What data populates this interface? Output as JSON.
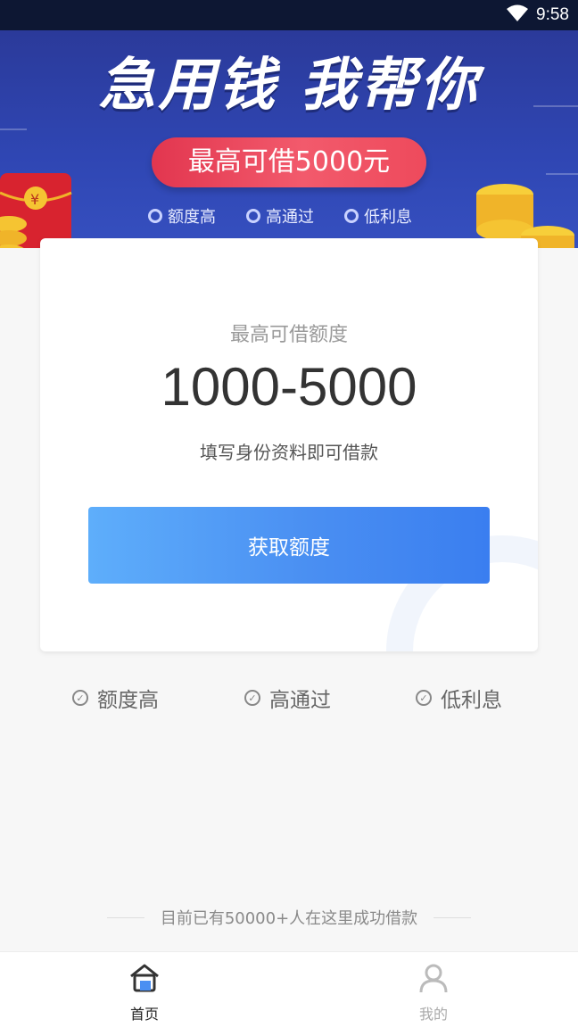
{
  "status_bar": {
    "time": "9:58"
  },
  "banner": {
    "title": "急用钱 我帮你",
    "pill": "最高可借5000元",
    "features": [
      "额度高",
      "高通过",
      "低利息"
    ]
  },
  "card": {
    "label": "最高可借额度",
    "amount": "1000-5000",
    "hint": "填写身份资料即可借款",
    "button": "获取额度"
  },
  "features": [
    "额度高",
    "高通过",
    "低利息"
  ],
  "footer_note": "目前已有50000+人在这里成功借款",
  "bottom_nav": {
    "items": [
      {
        "label": "首页",
        "icon": "home-icon",
        "active": true
      },
      {
        "label": "我的",
        "icon": "user-icon",
        "active": false
      }
    ]
  },
  "colors": {
    "banner": "#2f46b3",
    "pill": "#e2364f",
    "button": "#4a8ff2",
    "nav_active": "#222222",
    "nav_inactive": "#aaaaaa"
  }
}
